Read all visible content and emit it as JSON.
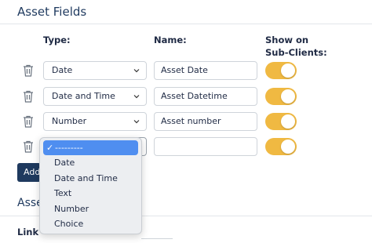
{
  "section": {
    "title": "Asset Fields",
    "second_title": "Asset",
    "link_label": "Link C"
  },
  "columns": {
    "type": "Type:",
    "name": "Name:",
    "show": "Show on Sub-Clients:"
  },
  "rows": [
    {
      "type": "Date",
      "name": "Asset Date",
      "show_on_subclients": true
    },
    {
      "type": "Date and Time",
      "name": "Asset Datetime",
      "show_on_subclients": true
    },
    {
      "type": "Number",
      "name": "Asset number",
      "show_on_subclients": true
    },
    {
      "type": "---------",
      "name": "",
      "show_on_subclients": true
    }
  ],
  "add_button": {
    "label": "Add"
  },
  "dropdown": {
    "selected": "---------",
    "check": "✓",
    "options": [
      "Date",
      "Date and Time",
      "Text",
      "Number",
      "Choice"
    ]
  },
  "colors": {
    "accent_toggle": "#f0b942",
    "primary": "#1f3a5f",
    "highlight": "#4f8ef0"
  },
  "icons": {
    "delete": "trash-icon",
    "dropdown_arrow": "chevron-updown-icon",
    "selected_mark": "check-icon"
  }
}
